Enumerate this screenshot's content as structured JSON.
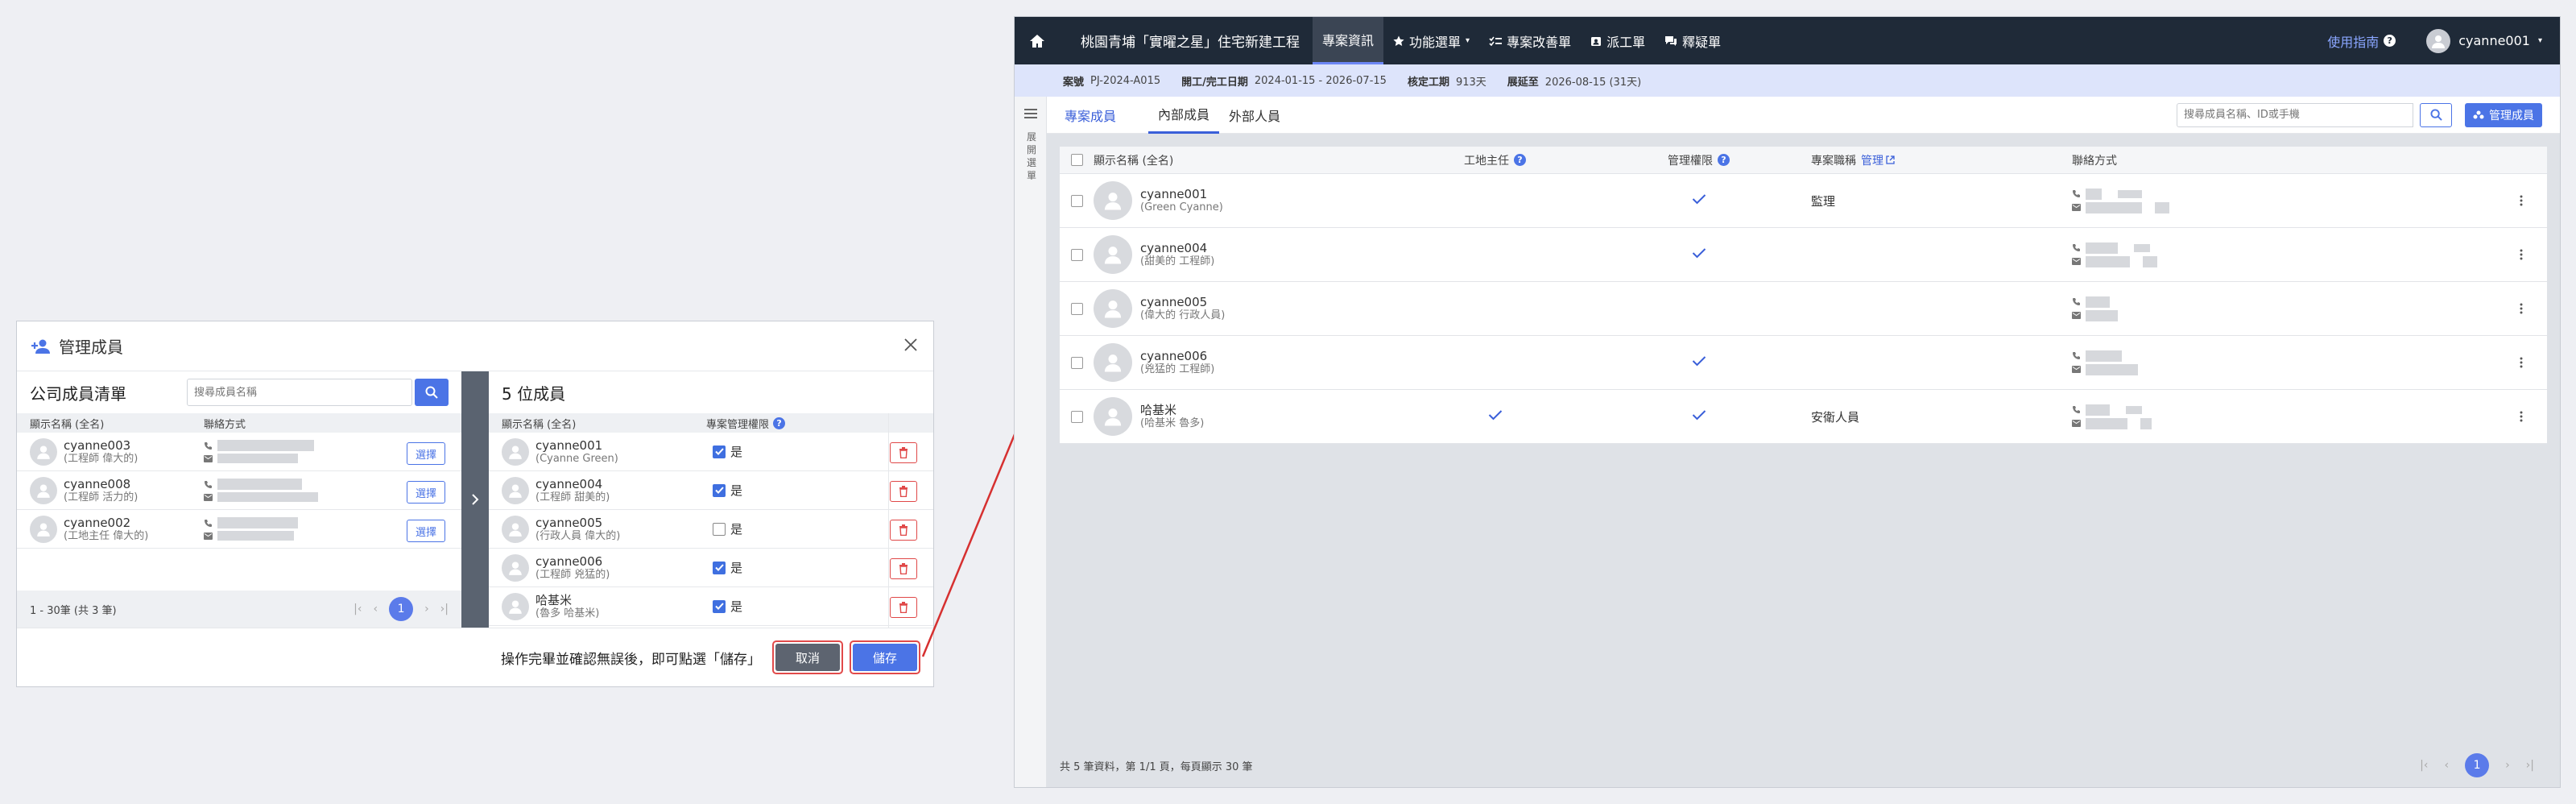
{
  "modal": {
    "title": "管理成員",
    "company_list": {
      "title": "公司成員清單",
      "search_placeholder": "搜尋成員名稱",
      "columns": [
        "顯示名稱 (全名)",
        "聯絡方式"
      ],
      "rows": [
        {
          "name": "cyanne003",
          "sub": "(工程師 偉大的)",
          "select_label": "選擇"
        },
        {
          "name": "cyanne008",
          "sub": "(工程師 活力的)",
          "select_label": "選擇"
        },
        {
          "name": "cyanne002",
          "sub": "(工地主任 偉大的)",
          "select_label": "選擇"
        }
      ],
      "footer": "1 - 30筆 (共 3 筆)",
      "page": "1"
    },
    "members": {
      "title": "5 位成員",
      "columns": [
        "顯示名稱 (全名)",
        "專案管理權限"
      ],
      "perm_label": "是",
      "rows": [
        {
          "name": "cyanne001",
          "sub": "(Cyanne Green)",
          "checked": true
        },
        {
          "name": "cyanne004",
          "sub": "(工程師 甜美的)",
          "checked": true
        },
        {
          "name": "cyanne005",
          "sub": "(行政人員 偉大的)",
          "checked": false
        },
        {
          "name": "cyanne006",
          "sub": "(工程師 兇猛的)",
          "checked": true
        },
        {
          "name": "哈基米",
          "sub": "(魯多 哈基米)",
          "checked": true
        }
      ]
    },
    "footer_note": "操作完畢並確認無誤後，即可點選「儲存」",
    "cancel_label": "取消",
    "save_label": "儲存"
  },
  "app": {
    "project_title": "桃園青埔「實曜之星」住宅新建工程",
    "nav": [
      {
        "label": "專案資訊",
        "active": true
      },
      {
        "label": "功能選單",
        "icon": "star-icon"
      },
      {
        "label": "專案改善單",
        "icon": "tasks-icon"
      },
      {
        "label": "派工單",
        "icon": "badge-icon"
      },
      {
        "label": "釋疑單",
        "icon": "chat-icon"
      }
    ],
    "guide_label": "使用指南",
    "user_name": "cyanne001",
    "info": {
      "code_label": "案號",
      "code": "PJ-2024-A015",
      "date_label": "開工/完工日期",
      "date": "2024-01-15 - 2026-07-15",
      "days_label": "核定工期",
      "days": "913天",
      "ext_label": "展延至",
      "ext": "2026-08-15 (31天)"
    },
    "sidebar_text": "展開選單",
    "tab_main": "專案成員",
    "tabs": [
      "內部成員",
      "外部人員"
    ],
    "search_placeholder": "搜尋成員名稱、ID或手機",
    "manage_label": "管理成員",
    "table": {
      "columns": {
        "name": "顯示名稱 (全名)",
        "site": "工地主任",
        "perm": "管理權限",
        "role": "專案職稱",
        "role_link": "管理",
        "contact": "聯絡方式"
      },
      "rows": [
        {
          "name": "cyanne001",
          "sub": "(Green Cyanne)",
          "site": false,
          "perm": true,
          "role": "監理"
        },
        {
          "name": "cyanne004",
          "sub": "(甜美的 工程師)",
          "site": false,
          "perm": true,
          "role": ""
        },
        {
          "name": "cyanne005",
          "sub": "(偉大的 行政人員)",
          "site": false,
          "perm": false,
          "role": ""
        },
        {
          "name": "cyanne006",
          "sub": "(兇猛的 工程師)",
          "site": false,
          "perm": true,
          "role": ""
        },
        {
          "name": "哈基米",
          "sub": "(哈基米 魯多)",
          "site": true,
          "perm": true,
          "role": "安衛人員"
        }
      ]
    },
    "footer": "共 5 筆資料，第 1/1 頁，每頁顯示 30 筆",
    "page": "1"
  }
}
